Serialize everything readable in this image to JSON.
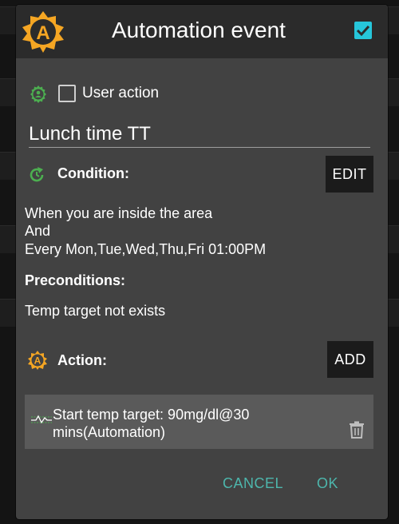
{
  "dialog": {
    "title": "Automation event",
    "app_icon": "androidaps-logo-icon",
    "title_checkbox_checked": true,
    "accent_color": "#26c6da"
  },
  "user_action": {
    "label": "User action",
    "checked": false,
    "icon": "user-gear-icon"
  },
  "event_name": {
    "value": "Lunch time TT"
  },
  "condition": {
    "label": "Condition:",
    "icon": "refresh-icon",
    "edit_label": "EDIT",
    "lines": [
      "When you are inside the area",
      "And",
      "Every Mon,Tue,Wed,Thu,Fri 01:00PM"
    ]
  },
  "preconditions": {
    "label": "Preconditions:",
    "text": "Temp target not exists"
  },
  "action": {
    "label": "Action:",
    "icon": "androidaps-logo-icon",
    "add_label": "ADD",
    "items": [
      {
        "line1": "Start temp target: 90mg/dl@30",
        "line2": "mins(Automation)",
        "icon": "temp-target-icon"
      }
    ]
  },
  "buttons": {
    "cancel": "CANCEL",
    "ok": "OK"
  },
  "colors": {
    "button_text": "#4db6ac",
    "icon_green": "#4caf50",
    "logo_orange": "#f5a623"
  }
}
